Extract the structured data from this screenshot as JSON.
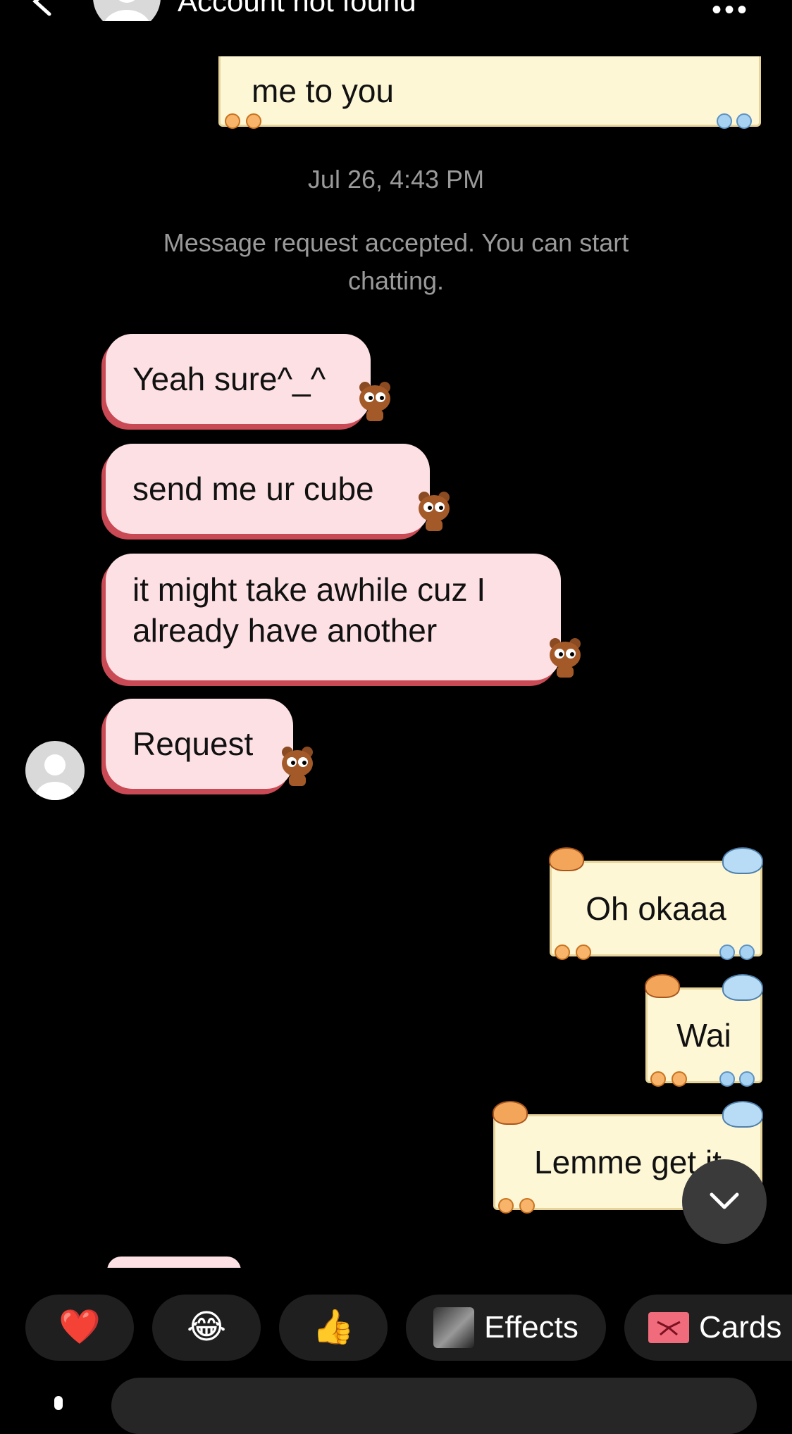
{
  "header": {
    "title": "Account not found",
    "back_icon": "chevron-left-icon",
    "more_icon": "more-horizontal-icon",
    "more_glyph": "•••"
  },
  "messages": {
    "out_partial": "me to you",
    "timestamp": "Jul 26, 4:43 PM",
    "system_notice": "Message request accepted. You can start chatting.",
    "in_1": "Yeah sure^_^",
    "in_2": "send me ur cube",
    "in_3": "it might take awhile cuz I already have another",
    "in_4": "Request",
    "out_1": "Oh okaaa",
    "out_2": "Wai",
    "out_3": "Lemme get it"
  },
  "quick_bar": {
    "heart": "❤️",
    "laugh": "😂",
    "thumbs": "👍",
    "effects_label": "Effects",
    "cards_label": "Cards"
  },
  "colors": {
    "incoming_bubble": "#fde0e4",
    "incoming_shadow": "#c94a55",
    "outgoing_bubble": "#fdf7d6",
    "background": "#000000"
  }
}
